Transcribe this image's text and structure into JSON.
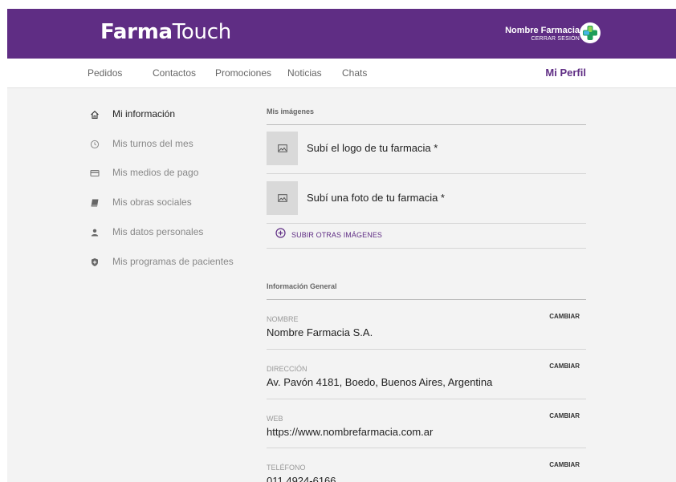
{
  "header": {
    "logo_bold": "Farma",
    "logo_light": "Touch",
    "pharmacy_name": "Nombre Farmacia",
    "logout": "CERRAR SESIÓN",
    "accent": "#5f2d84"
  },
  "nav": {
    "items": [
      {
        "label": "Pedidos"
      },
      {
        "label": "Contactos"
      },
      {
        "label": "Promociones"
      },
      {
        "label": "Noticias"
      },
      {
        "label": "Chats"
      }
    ],
    "profile": "Mi Perfil"
  },
  "sidebar": {
    "items": [
      {
        "label": "Mi información",
        "icon": "home-icon",
        "active": true
      },
      {
        "label": "Mis turnos del mes",
        "icon": "clock-icon",
        "active": false
      },
      {
        "label": "Mis medios de pago",
        "icon": "credit-card-icon",
        "active": false
      },
      {
        "label": "Mis obras sociales",
        "icon": "book-icon",
        "active": false
      },
      {
        "label": "Mis datos personales",
        "icon": "person-icon",
        "active": false
      },
      {
        "label": "Mis programas de pacientes",
        "icon": "shield-icon",
        "active": false
      }
    ]
  },
  "images": {
    "title": "Mis imágenes",
    "logo_upload": "Subí el logo de tu farmacia *",
    "photo_upload": "Subí una foto de tu farmacia *",
    "more": "SUBIR OTRAS IMÁGENES"
  },
  "general": {
    "title": "Información General",
    "change_label": "CAMBIAR",
    "fields": [
      {
        "label": "NOMBRE",
        "value": "Nombre Farmacia S.A."
      },
      {
        "label": "DIRECCIÓN",
        "value": "Av. Pavón 4181, Boedo, Buenos Aires, Argentina"
      },
      {
        "label": "WEB",
        "value": "https://www.nombrefarmacia.com.ar"
      },
      {
        "label": "TELÉFONO",
        "value": "011 4924-6166"
      }
    ]
  }
}
